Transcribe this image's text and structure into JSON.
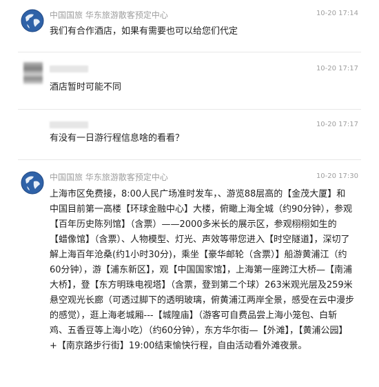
{
  "messages": [
    {
      "sender": "中国国旅 华东旅游散客预定中心",
      "time": "10-20 17:14",
      "avatar": "globe-icon",
      "text": "我们有合作酒店，如果有需要也可以给您们代定"
    },
    {
      "sender": "",
      "time": "10-20 17:17",
      "avatar": "blurred-avatar",
      "text": "酒店暂时可能不同"
    },
    {
      "sender": "",
      "time": "10-20 17:17",
      "avatar": "",
      "text": "有没有一日游行程信息啥的看看？"
    },
    {
      "sender": "中国国旅 华东旅游散客预定中心",
      "time": "10-20 17:30",
      "avatar": "globe-icon",
      "text": "上海市区免费接，8:00人民广场准时发车，、游览88层高的【金茂大厦】和中国目前第一高楼【环球金融中心】大楼，俯瞰上海全城（约90分钟），参观【百年历史陈列馆】（含票）——2000多米长的展示区，参观栩栩如生的【蜡像馆】（含票）、人物模型、灯光、声效等带您进入【时空隧道】，深切了解上海百年沧桑(约1小时30分)，乘坐【豪华邮轮（含票）】船游黄浦江（约60分钟），游【浦东新区】，观【中国国家馆】，上海第一座跨江大桥—【南浦大桥】，登【东方明珠电视塔】（含票，登到第二个球）263米观光层及259米悬空观光长廊（可透过脚下的透明玻璃，俯黄浦江两岸全景，感受在云中漫步的感觉），逛上海老城厢---【城隍庙】（游客可自费品尝上海小笼包、白斩鸡、五香豆等上海小吃）（约60分钟），东方华尔街—【外滩】，【黄浦公园】+【南京路步行街】19:00结束愉快行程，自由活动看外滩夜景。"
    }
  ]
}
